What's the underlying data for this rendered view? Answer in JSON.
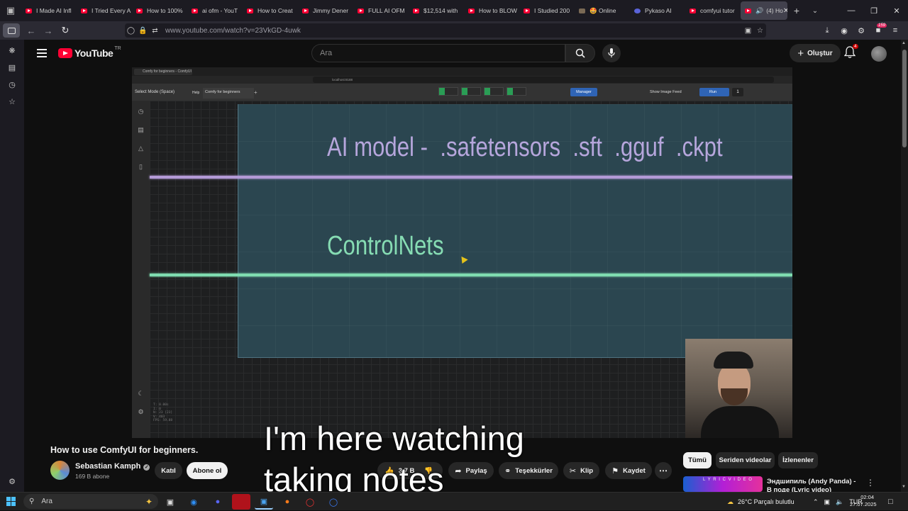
{
  "browser": {
    "tabs": [
      {
        "label": "I Made AI Infl",
        "icon": "youtube-icon"
      },
      {
        "label": "I Tried Every A",
        "icon": "youtube-icon"
      },
      {
        "label": "How to 100%",
        "icon": "youtube-icon"
      },
      {
        "label": "ai ofm - YouT",
        "icon": "youtube-icon"
      },
      {
        "label": "How to Creat",
        "icon": "youtube-icon"
      },
      {
        "label": "Jimmy Dener",
        "icon": "youtube-icon"
      },
      {
        "label": "FULL AI OFM",
        "icon": "youtube-icon"
      },
      {
        "label": "$12,514 with",
        "icon": "youtube-icon"
      },
      {
        "label": "How to BLOW",
        "icon": "youtube-icon"
      },
      {
        "label": "I Studied 200",
        "icon": "youtube-icon"
      },
      {
        "label": "🤩 Online",
        "icon": "image-icon"
      },
      {
        "label": "Pykaso AI",
        "icon": "globe-icon"
      },
      {
        "label": "comfyui tutor",
        "icon": "youtube-icon"
      },
      {
        "label": "(4) Ho",
        "icon": "youtube-icon",
        "active": true
      }
    ],
    "url": "www.youtube.com/watch?v=23VkGD-4uwk",
    "extension_badge": "159"
  },
  "youtube": {
    "logo_text": "YouTube",
    "region": "TR",
    "search_placeholder": "Ara",
    "create_label": "Oluştur",
    "notif_count": "4",
    "video_title": "How to use ComfyUI for beginners.",
    "channel_name": "Sebastian Kamph",
    "subscribers": "169 B abone",
    "join_label": "Katıl",
    "subscribe_label": "Abone ol",
    "likes": "3,7 B",
    "share_label": "Paylaş",
    "thanks_label": "Teşekkürler",
    "clip_label": "Klip",
    "save_label": "Kaydet",
    "chips": [
      "Tümü",
      "Seriden videolar",
      "İzlenenler"
    ],
    "rec_title": "Эндшипиль (Andy Panda) - B поде (Lyric video)",
    "rec_thumb_text": "L Y R I C   V I D E O",
    "caption": "I'm here watching\ntaking notes"
  },
  "video_frame": {
    "tab_title": "Comfy for beginners - ComfyUI",
    "url": "localhost:8188",
    "mode_label": "Select Mode (Space)",
    "help_label": "Help",
    "workflow_tab": "Comfy for beginners",
    "manager_label": "Manager",
    "share_image_feed": "Show Image Feed",
    "run_label": "Run",
    "batch": "1",
    "headline1": "AI model -  .safetensors  .sft  .gguf  .ckpt",
    "headline2": "ControlNets",
    "stats": "T: 0.00s\nI: 0\nN: 23 [23]\nV: 403\nFPS: 59.88"
  },
  "taskbar": {
    "search_placeholder": "Ara",
    "weather": "26°C  Parçalı bulutlu",
    "lang": "TUR",
    "time": "02:04",
    "date": "27.07.2025"
  },
  "colors": {
    "accent_red": "#ff0033",
    "note_bg": "#2b4650",
    "purple_line": "#b39ad6",
    "green_line": "#7fdcb0"
  }
}
